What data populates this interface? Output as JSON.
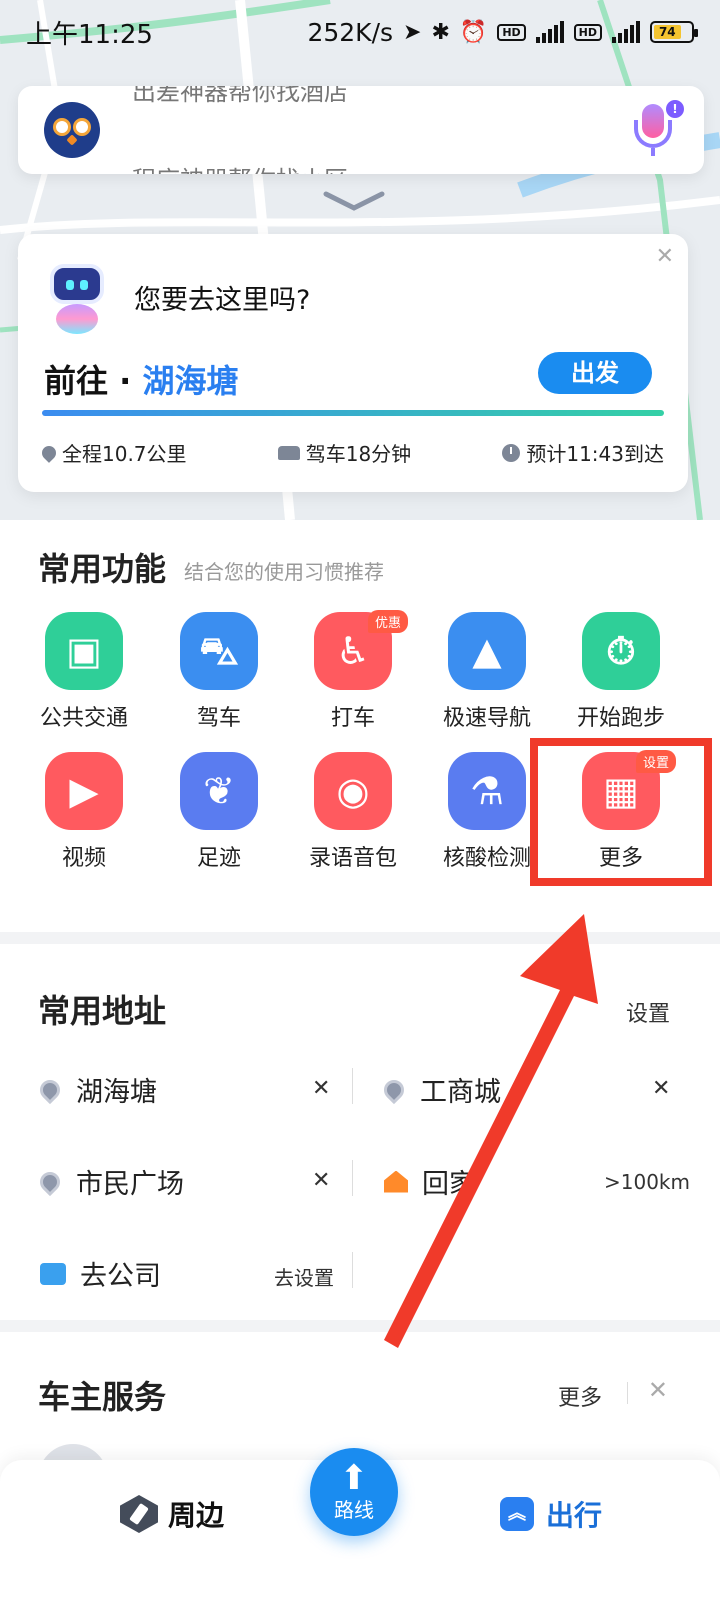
{
  "status_bar": {
    "time": "上午11:25",
    "speed": "252K/s",
    "battery": "74"
  },
  "search": {
    "hint_top": "出差神器帮你找酒店",
    "hint_bottom": "程序神器帮你找小区"
  },
  "destination": {
    "question": "您要去这里吗?",
    "goto_prefix": "前往 · ",
    "place": "湖海塘",
    "go_button": "出发",
    "distance": "全程10.7公里",
    "drive": "驾车18分钟",
    "eta": "预计11:43到达"
  },
  "functions": {
    "title": "常用功能",
    "subtitle": "结合您的使用习惯推荐",
    "items": [
      {
        "label": "公共交通",
        "icon": "bus-icon",
        "color": "#2fcf98"
      },
      {
        "label": "驾车",
        "icon": "car-icon",
        "color": "#3b8ef0"
      },
      {
        "label": "打车",
        "icon": "taxi-icon",
        "color": "#ff5a5f",
        "badge": "优惠"
      },
      {
        "label": "极速导航",
        "icon": "navigation-arrow-icon",
        "color": "#3b8ef0"
      },
      {
        "label": "开始跑步",
        "icon": "stopwatch-icon",
        "color": "#2fcf98"
      },
      {
        "label": "视频",
        "icon": "play-icon",
        "color": "#ff5a5f"
      },
      {
        "label": "足迹",
        "icon": "footprint-icon",
        "color": "#5a7cf0"
      },
      {
        "label": "录语音包",
        "icon": "record-icon",
        "color": "#ff5a5f"
      },
      {
        "label": "核酸检测",
        "icon": "test-tube-icon",
        "color": "#5a7cf0"
      },
      {
        "label": "更多",
        "icon": "grid-icon",
        "color": "#ff5a5f",
        "badge": "设置"
      }
    ]
  },
  "addresses": {
    "title": "常用地址",
    "settings": "设置",
    "items": [
      {
        "label": "湖海塘",
        "icon": "pin-icon",
        "action": "✕"
      },
      {
        "label": "工商城",
        "icon": "pin-icon",
        "action": "✕"
      },
      {
        "label": "市民广场",
        "icon": "pin-icon",
        "action": "✕"
      },
      {
        "label": "回家",
        "icon": "home-icon",
        "action": ">100km"
      },
      {
        "label": "去公司",
        "icon": "briefcase-icon",
        "action": "去设置"
      }
    ]
  },
  "owner_service": {
    "title": "车主服务",
    "more": "更多"
  },
  "bottom_nav": {
    "nearby": "周边",
    "route": "路线",
    "travel": "出行"
  },
  "colors": {
    "accent": "#1a8cf0",
    "annotation_red": "#f03a2a"
  }
}
